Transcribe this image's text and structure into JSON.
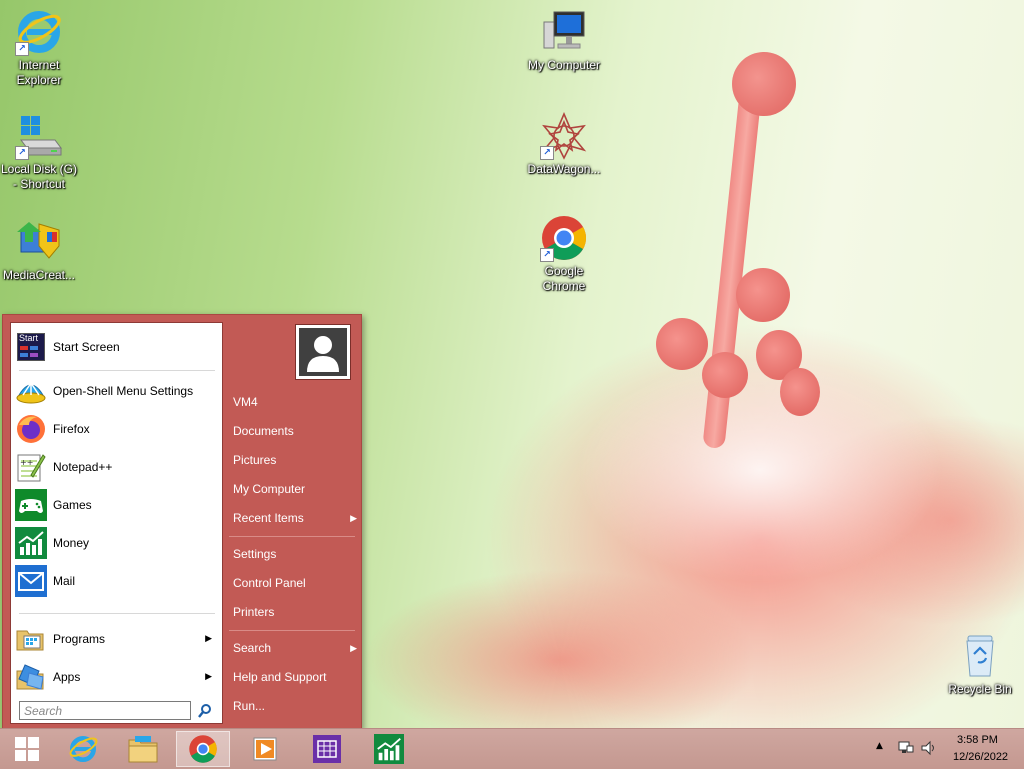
{
  "desktop": {
    "icons": [
      {
        "label_line1": "Internet",
        "label_line2": "Explorer"
      },
      {
        "label_line1": "Local Disk (G)",
        "label_line2": "- Shortcut"
      },
      {
        "label_line1": "MediaCreat...",
        "label_line2": ""
      },
      {
        "label_line1": "My Computer",
        "label_line2": ""
      },
      {
        "label_line1": "DataWagon...",
        "label_line2": ""
      },
      {
        "label_line1": "Google",
        "label_line2": "Chrome"
      },
      {
        "label_line1": "Recycle Bin",
        "label_line2": ""
      }
    ]
  },
  "start_menu": {
    "start_screen_icon_text": "Start",
    "pinned": [
      {
        "label": "Start Screen"
      },
      {
        "label": "Open-Shell Menu Settings"
      },
      {
        "label": "Firefox"
      },
      {
        "label": "Notepad++"
      },
      {
        "label": "Games"
      },
      {
        "label": "Money"
      },
      {
        "label": "Mail"
      }
    ],
    "programs_label": "Programs",
    "apps_label": "Apps",
    "search_placeholder": "Search",
    "right": {
      "user": "VM4",
      "documents": "Documents",
      "pictures": "Pictures",
      "my_computer": "My Computer",
      "recent_items": "Recent Items",
      "settings": "Settings",
      "control_panel": "Control Panel",
      "printers": "Printers",
      "search": "Search",
      "help": "Help and Support",
      "run": "Run..."
    },
    "accent_color": "#c25a55"
  },
  "taskbar": {
    "time": "3:58 PM",
    "date": "12/26/2022"
  }
}
